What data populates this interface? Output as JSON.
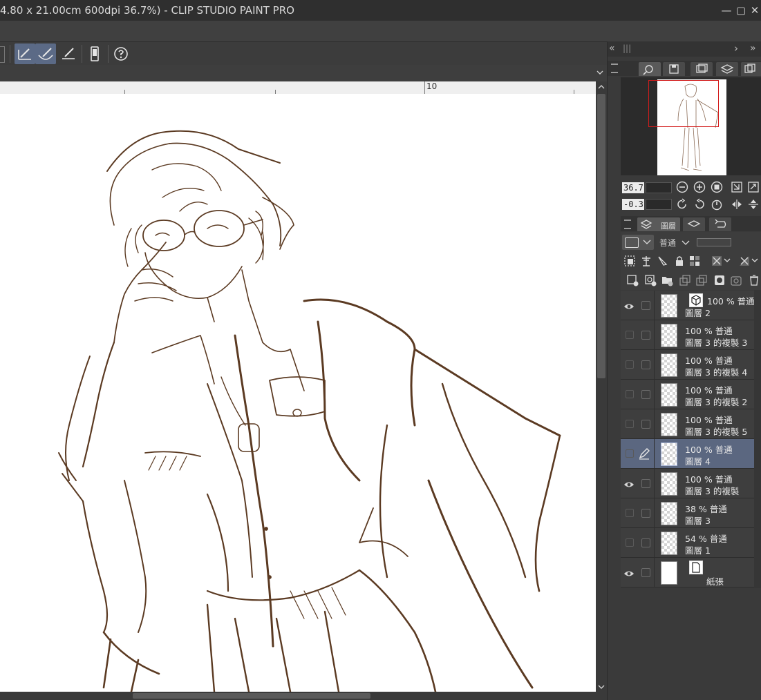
{
  "window": {
    "title": "4.80 x 21.00cm 600dpi 36.7%)  - CLIP STUDIO PAINT PRO",
    "min_label": "—",
    "max_label": "▢",
    "close_label": "✕"
  },
  "ruler": {
    "label": "10"
  },
  "panel_nav": {
    "collapse_left": "«",
    "grip": "|||",
    "expand_right": "›",
    "collapse_right": "»"
  },
  "navigator": {
    "zoom_value": "36.7",
    "rotate_value": "-0.3"
  },
  "layer_panel": {
    "tab_label": "圖層",
    "blend_mode": "普通",
    "layers": [
      {
        "opacity_blend": "100 % 普通",
        "name": "圖層 2",
        "visible": true,
        "kind": "3d"
      },
      {
        "opacity_blend": "100 % 普通",
        "name": "圖層 3 的複製 3",
        "visible": false,
        "kind": "raster"
      },
      {
        "opacity_blend": "100 % 普通",
        "name": "圖層 3 的複製 4",
        "visible": false,
        "kind": "raster"
      },
      {
        "opacity_blend": "100 % 普通",
        "name": "圖層 3 的複製 2",
        "visible": false,
        "kind": "raster"
      },
      {
        "opacity_blend": "100 % 普通",
        "name": "圖層 3 的複製 5",
        "visible": false,
        "kind": "raster"
      },
      {
        "opacity_blend": "100 % 普通",
        "name": "圖層 4",
        "visible": false,
        "kind": "raster",
        "selected": true,
        "editing": true
      },
      {
        "opacity_blend": "100 % 普通",
        "name": "圖層 3 的複製",
        "visible": true,
        "kind": "raster"
      },
      {
        "opacity_blend": "38 % 普通",
        "name": "圖層 3",
        "visible": false,
        "kind": "raster"
      },
      {
        "opacity_blend": "54 % 普通",
        "name": "圖層 1",
        "visible": false,
        "kind": "raster"
      },
      {
        "opacity_blend": "",
        "name": "紙張",
        "visible": true,
        "kind": "paper"
      }
    ]
  },
  "colors": {
    "line_art": "#5b3a22",
    "selected_row": "#5b6780",
    "nav_frame": "#d21c1c",
    "active_tool": "#5b6a86"
  }
}
